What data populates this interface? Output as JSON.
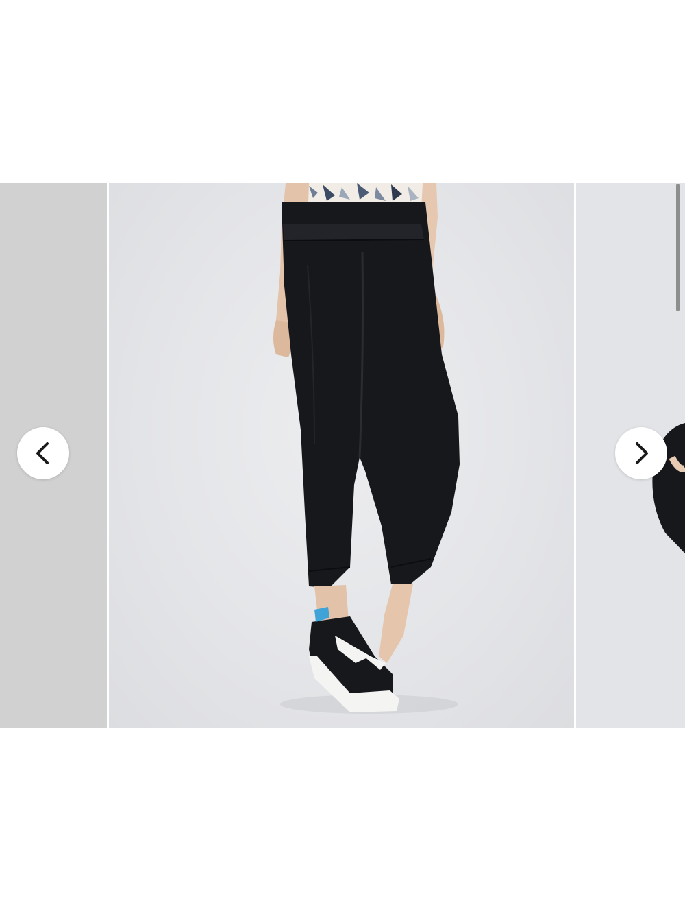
{
  "carousel": {
    "previous_button": {
      "icon": "chevron-left-icon"
    },
    "next_button": {
      "icon": "chevron-right-icon"
    },
    "slides": [
      {
        "role": "previous"
      },
      {
        "role": "current"
      },
      {
        "role": "next"
      }
    ]
  },
  "colors": {
    "page_background": "#ffffff",
    "photo_background": "#e4e5e8",
    "pants": "#17181c",
    "button_background": "#ffffff",
    "chevron": "#1a1a1a"
  }
}
